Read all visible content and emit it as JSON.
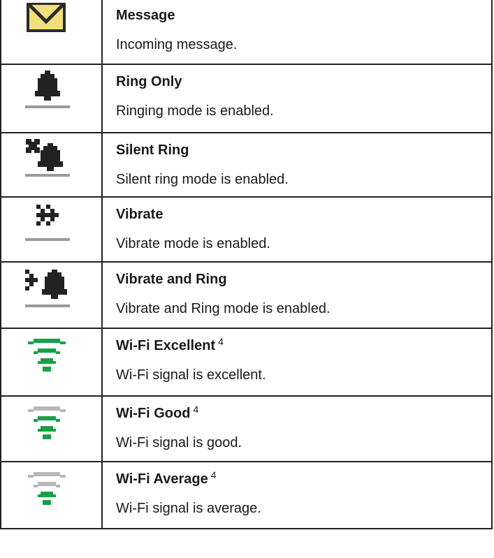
{
  "rows": [
    {
      "icon": "envelope-icon",
      "title": "Message",
      "sup": "",
      "desc": "Incoming message."
    },
    {
      "icon": "bell-icon",
      "title": "Ring Only",
      "sup": "",
      "desc": "Ringing mode is enabled."
    },
    {
      "icon": "silent-bell-icon",
      "title": "Silent Ring",
      "sup": "",
      "desc": "Silent ring mode is enabled."
    },
    {
      "icon": "vibrate-icon",
      "title": "Vibrate",
      "sup": "",
      "desc": "Vibrate mode is enabled."
    },
    {
      "icon": "vibrate-bell-icon",
      "title": "Vibrate and Ring",
      "sup": "",
      "desc": "Vibrate and Ring mode is enabled."
    },
    {
      "icon": "wifi-excellent-icon",
      "title": "Wi-Fi Excellent",
      "sup": "4",
      "desc": "Wi-Fi signal is excellent."
    },
    {
      "icon": "wifi-good-icon",
      "title": "Wi-Fi Good",
      "sup": "4",
      "desc": "Wi-Fi signal is good."
    },
    {
      "icon": "wifi-average-icon",
      "title": "Wi-Fi Average",
      "sup": "4",
      "desc": "Wi-Fi signal is average."
    }
  ],
  "colors": {
    "border": "#222222",
    "wifi_green": "#17a046",
    "wifi_gray": "#b8b8b8",
    "icon_dark": "#222222",
    "baseline_gray": "#9a9a9a",
    "envelope_fill": "#f1e07a"
  }
}
